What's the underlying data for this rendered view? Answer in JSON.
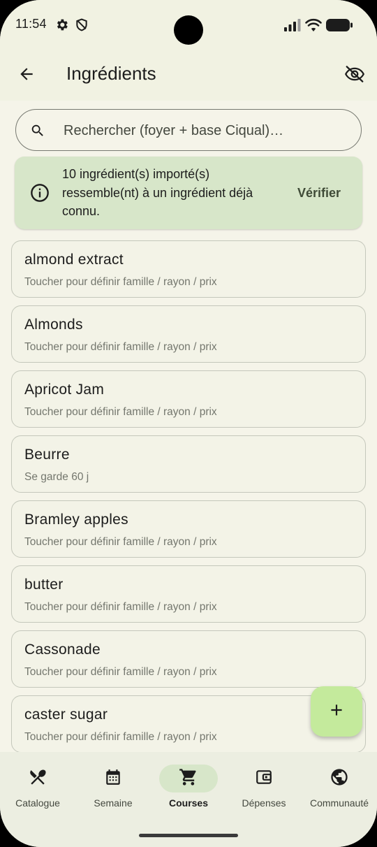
{
  "status_bar": {
    "time": "11:54",
    "icons": [
      "gear-icon",
      "shield-icon",
      "signal-icon",
      "wifi-icon",
      "battery-icon"
    ]
  },
  "app_bar": {
    "title": "Ingrédients",
    "back_icon": "arrow-back-icon",
    "visibility_icon": "eye-off-icon"
  },
  "search": {
    "placeholder": "Rechercher (foyer + base Ciqual)…",
    "value": ""
  },
  "banner": {
    "message": "10 ingrédient(s) importé(s) ressemble(nt) à un ingrédient déjà connu.",
    "action_label": "Vérifier",
    "icon": "info-icon"
  },
  "ingredients": [
    {
      "name": "almond extract",
      "subtitle": "Toucher pour définir famille / rayon / prix"
    },
    {
      "name": "Almonds",
      "subtitle": "Toucher pour définir famille / rayon / prix"
    },
    {
      "name": "Apricot Jam",
      "subtitle": "Toucher pour définir famille / rayon / prix"
    },
    {
      "name": "Beurre",
      "subtitle": "Se garde 60 j"
    },
    {
      "name": "Bramley apples",
      "subtitle": "Toucher pour définir famille / rayon / prix"
    },
    {
      "name": "butter",
      "subtitle": "Toucher pour définir famille / rayon / prix"
    },
    {
      "name": "Cassonade",
      "subtitle": "Toucher pour définir famille / rayon / prix"
    },
    {
      "name": "caster sugar",
      "subtitle": "Toucher pour définir famille / rayon / prix"
    }
  ],
  "fab": {
    "icon": "plus-icon"
  },
  "bottom_nav": [
    {
      "label": "Catalogue",
      "icon": "utensils-icon",
      "active": false
    },
    {
      "label": "Semaine",
      "icon": "calendar-icon",
      "active": false
    },
    {
      "label": "Courses",
      "icon": "cart-icon",
      "active": true
    },
    {
      "label": "Dépenses",
      "icon": "wallet-icon",
      "active": false
    },
    {
      "label": "Communauté",
      "icon": "globe-icon",
      "active": false
    }
  ],
  "colors": {
    "background": "#f5f4e9",
    "accent_container": "#d7e6c9",
    "fab": "#c4ea9c",
    "text": "#1c1c1c"
  }
}
